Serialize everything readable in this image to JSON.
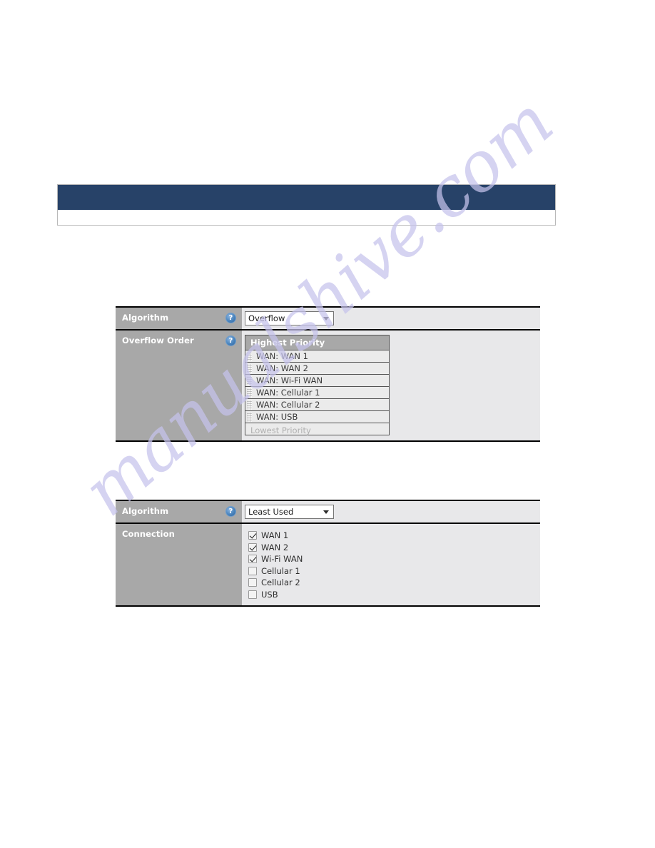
{
  "watermark": {
    "text": "manualshive.com"
  },
  "page_header": {
    "title": "",
    "subtitle": ""
  },
  "tables": [
    {
      "id": "overflow-table",
      "rows": [
        {
          "label": "Algorithm",
          "has_help": true,
          "help_icon": "question-mark-icon",
          "control": "select",
          "select_value": "Overflow"
        },
        {
          "label": "Overflow Order",
          "has_help": true,
          "help_icon": "question-mark-icon",
          "control": "priority-list",
          "list_header": "Highest Priority",
          "list_footer": "Lowest Priority",
          "items": [
            "WAN: WAN 1",
            "WAN: WAN 2",
            "WAN: Wi-Fi WAN",
            "WAN: Cellular 1",
            "WAN: Cellular 2",
            "WAN: USB"
          ]
        }
      ]
    },
    {
      "id": "least-used-table",
      "rows": [
        {
          "label": "Algorithm",
          "has_help": true,
          "help_icon": "question-mark-icon",
          "control": "select",
          "select_value": "Least Used"
        },
        {
          "label": "Connection",
          "has_help": false,
          "control": "checkbox-list",
          "items": [
            {
              "label": "WAN 1",
              "checked": true
            },
            {
              "label": "WAN 2",
              "checked": true
            },
            {
              "label": "Wi-Fi WAN",
              "checked": true
            },
            {
              "label": "Cellular 1",
              "checked": false
            },
            {
              "label": "Cellular 2",
              "checked": false
            },
            {
              "label": "USB",
              "checked": false
            }
          ]
        }
      ]
    }
  ],
  "colors": {
    "header_bar": "#274268",
    "label_bg": "#a8a8a8",
    "panel_bg": "#e8e8ea",
    "help_icon": "#4a84bd",
    "watermark": "#c6c3ec"
  },
  "help_glyph": "?"
}
